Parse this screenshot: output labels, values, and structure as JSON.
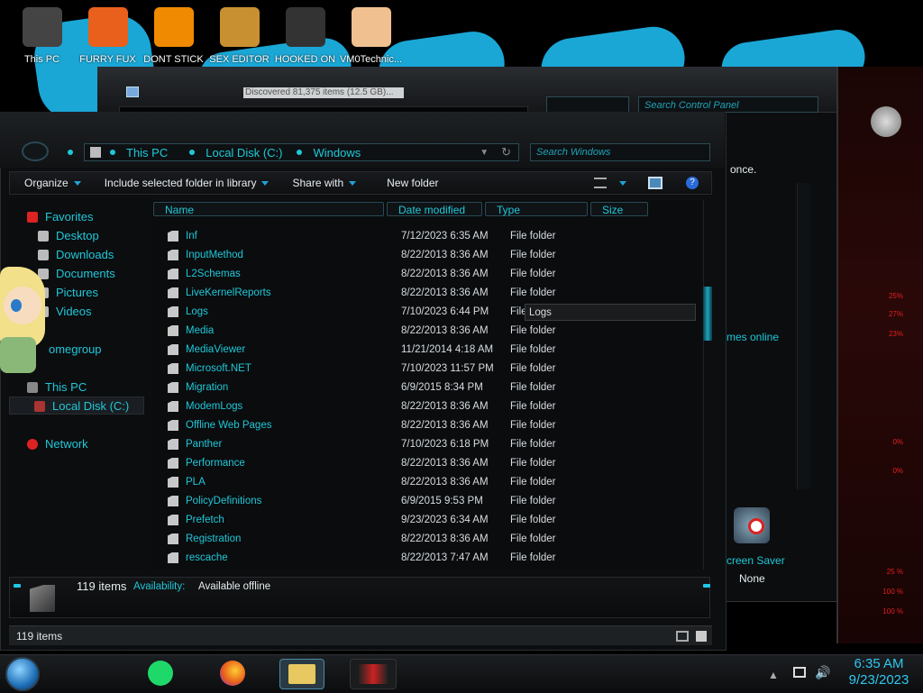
{
  "desktop": {
    "icons": [
      {
        "label": "This PC",
        "icon": "this-pc-icon",
        "color": "#444"
      },
      {
        "label": "FURRY FUX",
        "icon": "firefox-icon",
        "color": "#e8601c"
      },
      {
        "label": "DONT STICK",
        "icon": "vlc-icon",
        "color": "#f08a00"
      },
      {
        "label": "SEX EDITOR",
        "icon": "hxd-icon",
        "color": "#c89030"
      },
      {
        "label": "HOOKED ON",
        "icon": "maze-icon",
        "color": "#333"
      },
      {
        "label": "VM0Technic...",
        "icon": "doctor-icon",
        "color": "#f0c090"
      }
    ]
  },
  "control_panel": {
    "progress_text": "Discovered 81,375 items (12.5 GB)...",
    "search_placeholder": "Search Control Panel",
    "right_text_1": "once.",
    "right_text_2": "mes online",
    "screensaver_label": "creen Saver",
    "screensaver_value": "None"
  },
  "alienware_panel": {
    "percents": [
      "25%",
      "27%",
      "23%",
      "0%",
      "0%",
      "25 %",
      "100 %",
      "100 %"
    ]
  },
  "explorer": {
    "breadcrumbs": [
      "This PC",
      "Local Disk (C:)",
      "Windows"
    ],
    "search_placeholder": "Search Windows",
    "toolbar": {
      "organize": "Organize",
      "include_library": "Include selected folder in library",
      "share_with": "Share with",
      "new_folder": "New folder"
    },
    "nav": {
      "favorites": "Favorites",
      "desktop": "Desktop",
      "downloads": "Downloads",
      "documents": "Documents",
      "pictures": "Pictures",
      "videos": "Videos",
      "homegroup": "omegroup",
      "this_pc": "This PC",
      "local_disk": "Local Disk (C:)",
      "network": "Network"
    },
    "columns": [
      "Name",
      "Date modified",
      "Type",
      "Size"
    ],
    "rows": [
      {
        "name": "Inf",
        "date": "7/12/2023 6:35 AM",
        "type": "File folder"
      },
      {
        "name": "InputMethod",
        "date": "8/22/2013 8:36 AM",
        "type": "File folder"
      },
      {
        "name": "L2Schemas",
        "date": "8/22/2013 8:36 AM",
        "type": "File folder"
      },
      {
        "name": "LiveKernelReports",
        "date": "8/22/2013 8:36 AM",
        "type": "File folder"
      },
      {
        "name": "Logs",
        "date": "7/10/2023 6:44 PM",
        "type": "File folder"
      },
      {
        "name": "Media",
        "date": "8/22/2013 8:36 AM",
        "type": "File folder"
      },
      {
        "name": "MediaViewer",
        "date": "11/21/2014 4:18 AM",
        "type": "File folder"
      },
      {
        "name": "Microsoft.NET",
        "date": "7/10/2023 11:57 PM",
        "type": "File folder"
      },
      {
        "name": "Migration",
        "date": "6/9/2015 8:34 PM",
        "type": "File folder"
      },
      {
        "name": "ModemLogs",
        "date": "8/22/2013 8:36 AM",
        "type": "File folder"
      },
      {
        "name": "Offline Web Pages",
        "date": "8/22/2013 8:36 AM",
        "type": "File folder"
      },
      {
        "name": "Panther",
        "date": "7/10/2023 6:18 PM",
        "type": "File folder"
      },
      {
        "name": "Performance",
        "date": "8/22/2013 8:36 AM",
        "type": "File folder"
      },
      {
        "name": "PLA",
        "date": "8/22/2013 8:36 AM",
        "type": "File folder"
      },
      {
        "name": "PolicyDefinitions",
        "date": "6/9/2015 9:53 PM",
        "type": "File folder"
      },
      {
        "name": "Prefetch",
        "date": "9/23/2023 6:34 AM",
        "type": "File folder"
      },
      {
        "name": "Registration",
        "date": "8/22/2013 8:36 AM",
        "type": "File folder"
      },
      {
        "name": "rescache",
        "date": "8/22/2013 7:47 AM",
        "type": "File folder"
      }
    ],
    "tooltip": "Logs",
    "details": {
      "count": "119 items",
      "availability_label": "Availability:",
      "availability_value": "Available offline"
    },
    "status_count": "119 items"
  },
  "taskbar": {
    "time": "6:35 AM",
    "date": "9/23/2023"
  }
}
